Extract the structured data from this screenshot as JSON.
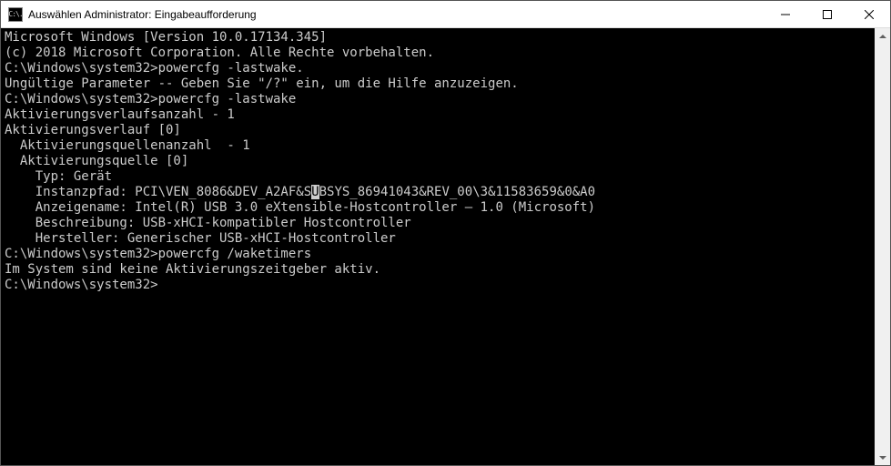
{
  "window": {
    "title": "Auswählen Administrator: Eingabeaufforderung",
    "icon_label": "cmd-icon",
    "icon_text": "C:\\."
  },
  "terminal": {
    "lines": [
      "Microsoft Windows [Version 10.0.17134.345]",
      "(c) 2018 Microsoft Corporation. Alle Rechte vorbehalten.",
      "",
      "C:\\Windows\\system32>powercfg -lastwake.",
      "Ungültige Parameter -- Geben Sie \"/?\" ein, um die Hilfe anzuzeigen.",
      "",
      "C:\\Windows\\system32>powercfg -lastwake",
      "Aktivierungsverlaufsanzahl - 1",
      "Aktivierungsverlauf [0]",
      "  Aktivierungsquellenanzahl  - 1",
      "  Aktivierungsquelle [0]",
      "    Typ: Gerät",
      "    Instanzpfad: PCI\\VEN_8086&DEV_A2AF&SUBSYS_86941043&REV_00\\3&11583659&0&A0",
      "    Anzeigename: Intel(R) USB 3.0 eXtensible-Hostcontroller – 1.0 (Microsoft)",
      "    Beschreibung: USB-xHCI-kompatibler Hostcontroller",
      "    Hersteller: Generischer USB-xHCI-Hostcontroller",
      "",
      "C:\\Windows\\system32>powercfg /waketimers",
      "Im System sind keine Aktivierungszeitgeber aktiv.",
      "",
      "C:\\Windows\\system32>"
    ],
    "selection": {
      "line": 12,
      "col": 40,
      "length": 1
    }
  },
  "buttons": {
    "minimize": "Minimieren",
    "maximize": "Maximieren",
    "close": "Schließen"
  }
}
